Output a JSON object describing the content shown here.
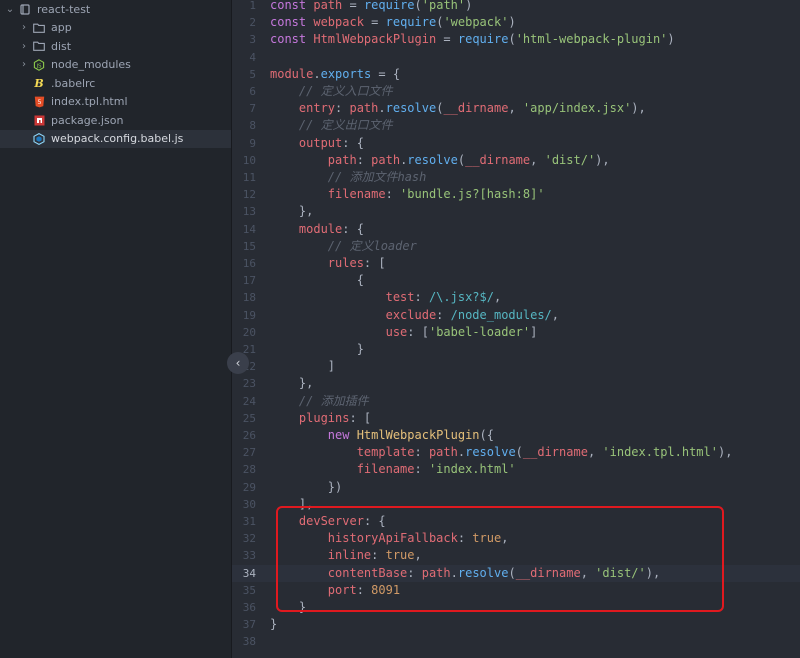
{
  "tree": {
    "root": {
      "label": "react-test",
      "icon": "repo-icon"
    },
    "items": [
      {
        "label": "app",
        "kind": "folder"
      },
      {
        "label": "dist",
        "kind": "folder"
      },
      {
        "label": "node_modules",
        "kind": "folder-node"
      },
      {
        "label": ".babelrc",
        "kind": "file-babel"
      },
      {
        "label": "index.tpl.html",
        "kind": "file-html"
      },
      {
        "label": "package.json",
        "kind": "file-npm"
      },
      {
        "label": "webpack.config.babel.js",
        "kind": "file-webpack",
        "selected": true
      }
    ]
  },
  "editor": {
    "current_line": 34,
    "lines": [
      {
        "n": "1",
        "t": [
          [
            "kw",
            "const "
          ],
          [
            "var",
            "path"
          ],
          [
            "pl",
            " = "
          ],
          [
            "fn",
            "require"
          ],
          [
            "pl",
            "("
          ],
          [
            "str",
            "'path'"
          ],
          [
            "pl",
            ")"
          ]
        ]
      },
      {
        "n": "2",
        "t": [
          [
            "kw",
            "const "
          ],
          [
            "var",
            "webpack"
          ],
          [
            "pl",
            " = "
          ],
          [
            "fn",
            "require"
          ],
          [
            "pl",
            "("
          ],
          [
            "str",
            "'webpack'"
          ],
          [
            "pl",
            ")"
          ]
        ]
      },
      {
        "n": "3",
        "t": [
          [
            "kw",
            "const "
          ],
          [
            "var",
            "HtmlWebpackPlugin"
          ],
          [
            "pl",
            " = "
          ],
          [
            "fn",
            "require"
          ],
          [
            "pl",
            "("
          ],
          [
            "str",
            "'html-webpack-plugin'"
          ],
          [
            "pl",
            ")"
          ]
        ]
      },
      {
        "n": "4",
        "t": []
      },
      {
        "n": "5",
        "t": [
          [
            "var",
            "module"
          ],
          [
            "pl",
            "."
          ],
          [
            "fn",
            "exports"
          ],
          [
            "pl",
            " = {"
          ]
        ]
      },
      {
        "n": "6",
        "t": [
          [
            "pl",
            "    "
          ],
          [
            "cm",
            "// 定义入口文件"
          ]
        ]
      },
      {
        "n": "7",
        "t": [
          [
            "pl",
            "    "
          ],
          [
            "prop",
            "entry"
          ],
          [
            "pl",
            ": "
          ],
          [
            "var",
            "path"
          ],
          [
            "pl",
            "."
          ],
          [
            "fn",
            "resolve"
          ],
          [
            "pl",
            "("
          ],
          [
            "var",
            "__dirname"
          ],
          [
            "pl",
            ", "
          ],
          [
            "str",
            "'app/index.jsx'"
          ],
          [
            "pl",
            "),"
          ]
        ]
      },
      {
        "n": "8",
        "t": [
          [
            "pl",
            "    "
          ],
          [
            "cm",
            "// 定义出口文件"
          ]
        ]
      },
      {
        "n": "9",
        "t": [
          [
            "pl",
            "    "
          ],
          [
            "prop",
            "output"
          ],
          [
            "pl",
            ": {"
          ]
        ]
      },
      {
        "n": "10",
        "t": [
          [
            "pl",
            "        "
          ],
          [
            "prop",
            "path"
          ],
          [
            "pl",
            ": "
          ],
          [
            "var",
            "path"
          ],
          [
            "pl",
            "."
          ],
          [
            "fn",
            "resolve"
          ],
          [
            "pl",
            "("
          ],
          [
            "var",
            "__dirname"
          ],
          [
            "pl",
            ", "
          ],
          [
            "str",
            "'dist/'"
          ],
          [
            "pl",
            "),"
          ]
        ]
      },
      {
        "n": "11",
        "t": [
          [
            "pl",
            "        "
          ],
          [
            "cm",
            "// 添加文件hash"
          ]
        ]
      },
      {
        "n": "12",
        "t": [
          [
            "pl",
            "        "
          ],
          [
            "prop",
            "filename"
          ],
          [
            "pl",
            ": "
          ],
          [
            "str",
            "'bundle.js?[hash:8]'"
          ]
        ]
      },
      {
        "n": "13",
        "t": [
          [
            "pl",
            "    },"
          ]
        ]
      },
      {
        "n": "14",
        "t": [
          [
            "pl",
            "    "
          ],
          [
            "prop",
            "module"
          ],
          [
            "pl",
            ": {"
          ]
        ]
      },
      {
        "n": "15",
        "t": [
          [
            "pl",
            "        "
          ],
          [
            "cm",
            "// 定义loader"
          ]
        ]
      },
      {
        "n": "16",
        "t": [
          [
            "pl",
            "        "
          ],
          [
            "prop",
            "rules"
          ],
          [
            "pl",
            ": ["
          ]
        ]
      },
      {
        "n": "17",
        "t": [
          [
            "pl",
            "            {"
          ]
        ]
      },
      {
        "n": "18",
        "t": [
          [
            "pl",
            "                "
          ],
          [
            "prop",
            "test"
          ],
          [
            "pl",
            ": "
          ],
          [
            "re",
            "/\\.jsx?$/"
          ],
          [
            "pl",
            ","
          ]
        ]
      },
      {
        "n": "19",
        "t": [
          [
            "pl",
            "                "
          ],
          [
            "prop",
            "exclude"
          ],
          [
            "pl",
            ": "
          ],
          [
            "re",
            "/node_modules/"
          ],
          [
            "pl",
            ","
          ]
        ]
      },
      {
        "n": "20",
        "t": [
          [
            "pl",
            "                "
          ],
          [
            "prop",
            "use"
          ],
          [
            "pl",
            ": ["
          ],
          [
            "str",
            "'babel-loader'"
          ],
          [
            "pl",
            "]"
          ]
        ]
      },
      {
        "n": "21",
        "t": [
          [
            "pl",
            "            }"
          ]
        ]
      },
      {
        "n": "22",
        "t": [
          [
            "pl",
            "        ]"
          ]
        ]
      },
      {
        "n": "23",
        "t": [
          [
            "pl",
            "    },"
          ]
        ]
      },
      {
        "n": "24",
        "t": [
          [
            "pl",
            "    "
          ],
          [
            "cm",
            "// 添加插件"
          ]
        ]
      },
      {
        "n": "25",
        "t": [
          [
            "pl",
            "    "
          ],
          [
            "prop",
            "plugins"
          ],
          [
            "pl",
            ": ["
          ]
        ]
      },
      {
        "n": "26",
        "t": [
          [
            "pl",
            "        "
          ],
          [
            "kw",
            "new "
          ],
          [
            "cls",
            "HtmlWebpackPlugin"
          ],
          [
            "pl",
            "({"
          ]
        ]
      },
      {
        "n": "27",
        "t": [
          [
            "pl",
            "            "
          ],
          [
            "prop",
            "template"
          ],
          [
            "pl",
            ": "
          ],
          [
            "var",
            "path"
          ],
          [
            "pl",
            "."
          ],
          [
            "fn",
            "resolve"
          ],
          [
            "pl",
            "("
          ],
          [
            "var",
            "__dirname"
          ],
          [
            "pl",
            ", "
          ],
          [
            "str",
            "'index.tpl.html'"
          ],
          [
            "pl",
            "),"
          ]
        ]
      },
      {
        "n": "28",
        "t": [
          [
            "pl",
            "            "
          ],
          [
            "prop",
            "filename"
          ],
          [
            "pl",
            ": "
          ],
          [
            "str",
            "'index.html'"
          ]
        ]
      },
      {
        "n": "29",
        "t": [
          [
            "pl",
            "        })"
          ]
        ]
      },
      {
        "n": "30",
        "t": [
          [
            "pl",
            "    ],"
          ]
        ]
      },
      {
        "n": "31",
        "t": [
          [
            "pl",
            "    "
          ],
          [
            "prop",
            "devServer"
          ],
          [
            "pl",
            ": {"
          ]
        ]
      },
      {
        "n": "32",
        "t": [
          [
            "pl",
            "        "
          ],
          [
            "prop",
            "historyApiFallback"
          ],
          [
            "pl",
            ": "
          ],
          [
            "num",
            "true"
          ],
          [
            "pl",
            ","
          ]
        ]
      },
      {
        "n": "33",
        "t": [
          [
            "pl",
            "        "
          ],
          [
            "prop",
            "inline"
          ],
          [
            "pl",
            ": "
          ],
          [
            "num",
            "true"
          ],
          [
            "pl",
            ","
          ]
        ]
      },
      {
        "n": "34",
        "t": [
          [
            "pl",
            "        "
          ],
          [
            "prop",
            "contentBase"
          ],
          [
            "pl",
            ": "
          ],
          [
            "var",
            "path"
          ],
          [
            "pl",
            "."
          ],
          [
            "fn",
            "resolve"
          ],
          [
            "pl",
            "("
          ],
          [
            "var",
            "__dirname"
          ],
          [
            "pl",
            ", "
          ],
          [
            "str",
            "'dist/'"
          ],
          [
            "pl",
            "),"
          ]
        ]
      },
      {
        "n": "35",
        "t": [
          [
            "pl",
            "        "
          ],
          [
            "prop",
            "port"
          ],
          [
            "pl",
            ": "
          ],
          [
            "num",
            "8091"
          ]
        ]
      },
      {
        "n": "36",
        "t": [
          [
            "pl",
            "    }"
          ]
        ]
      },
      {
        "n": "37",
        "t": [
          [
            "pl",
            "}"
          ]
        ]
      },
      {
        "n": "38",
        "t": []
      }
    ]
  },
  "colors": {
    "highlight_box": "#e0191f",
    "background": "#282c34",
    "sidebar": "#21252b"
  },
  "collapse_toggle": {
    "icon": "chevron-left-icon",
    "glyph": "‹"
  }
}
